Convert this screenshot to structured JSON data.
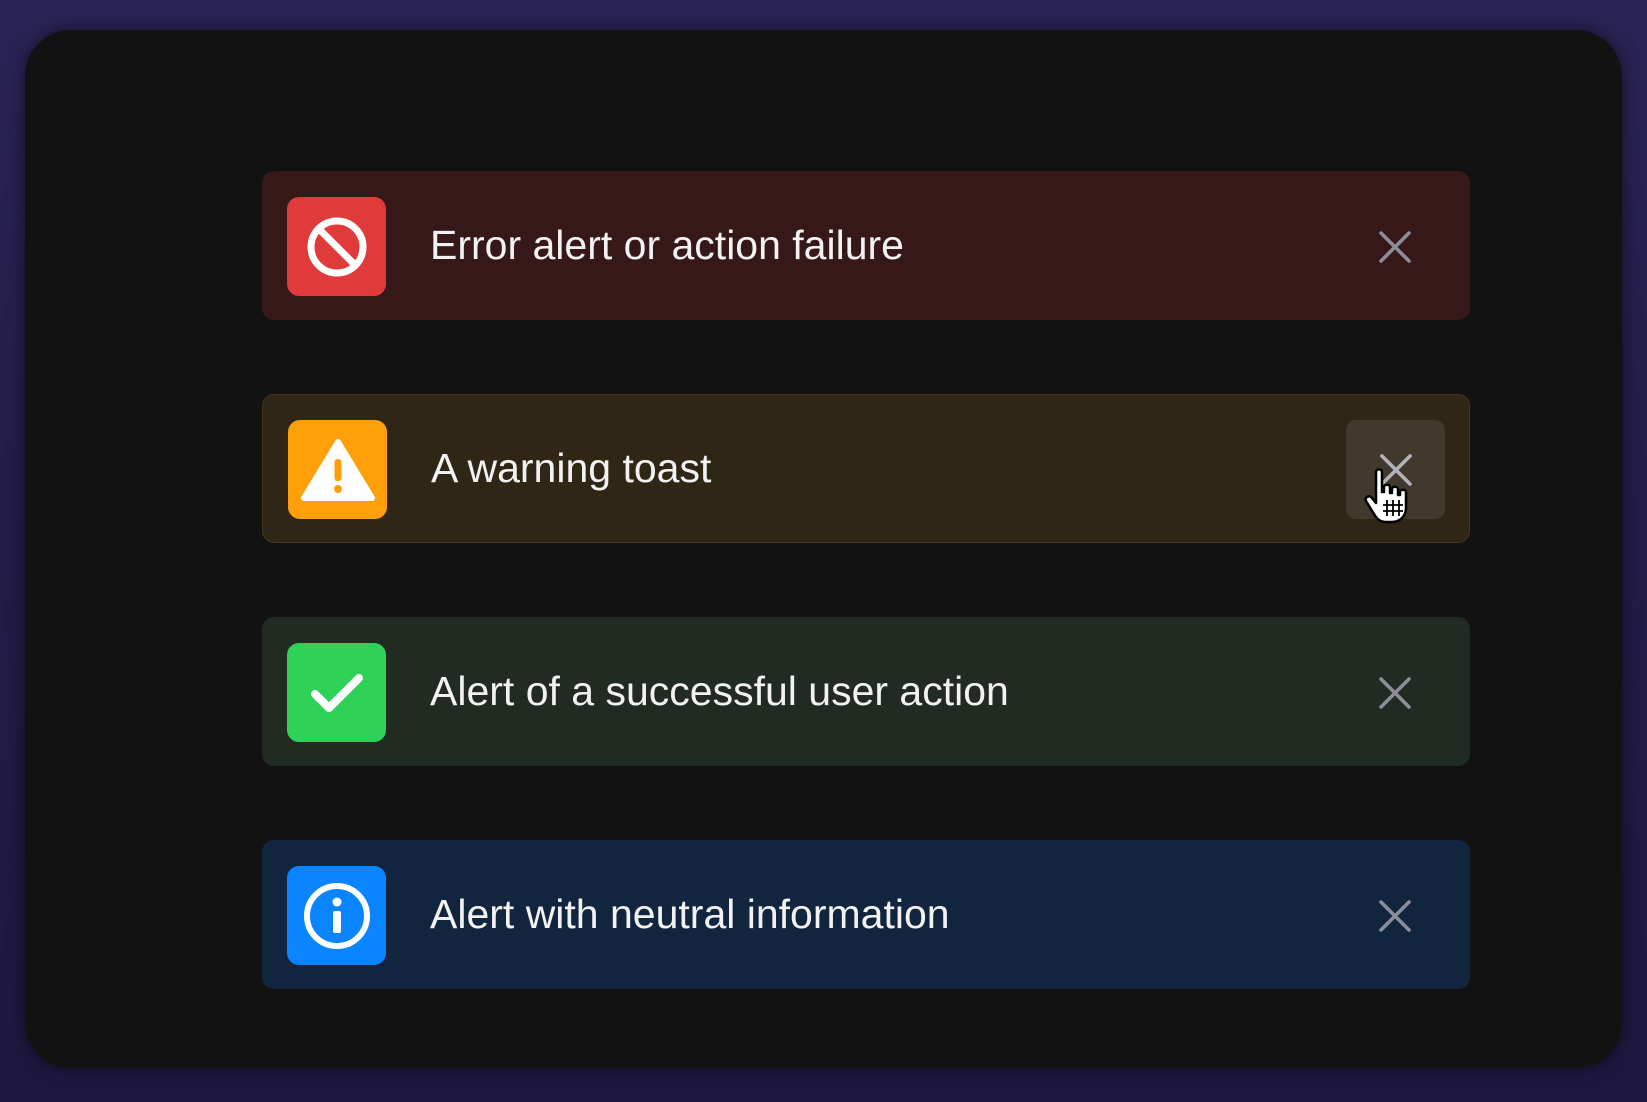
{
  "toasts": [
    {
      "type": "error",
      "icon": "prohibited-icon",
      "message": "Error alert or action failure",
      "accent_color": "#e03a3a",
      "background_color": "#361818"
    },
    {
      "type": "warning",
      "icon": "warning-triangle-icon",
      "message": "A warning toast",
      "accent_color": "#ff9f0a",
      "background_color": "#2f2616",
      "close_hovered": true
    },
    {
      "type": "success",
      "icon": "checkmark-icon",
      "message": "Alert of a successful user action",
      "accent_color": "#30d158",
      "background_color": "#212b21"
    },
    {
      "type": "info",
      "icon": "info-icon",
      "message": "Alert with neutral information",
      "accent_color": "#0a84ff",
      "background_color": "#12253e"
    }
  ],
  "close_icon": "close-icon",
  "page_background": "#251e4b",
  "panel_background": "#121212"
}
